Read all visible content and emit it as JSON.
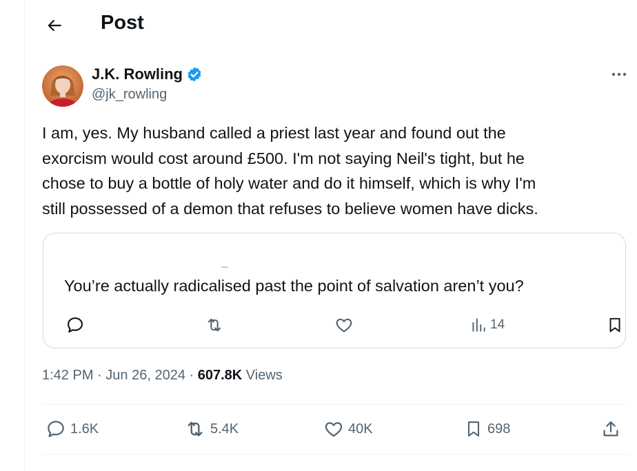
{
  "header": {
    "title": "Post",
    "back_icon": "arrow-left-icon"
  },
  "author": {
    "name": "J.K. Rowling",
    "handle": "@jk_rowling",
    "verified": true,
    "verified_color": "#1d9bf0"
  },
  "tweet": {
    "lines": [
      "I am, yes. My husband called a priest last year and found out the",
      "exorcism would cost around £500. I'm not saying Neil's tight, but he",
      "chose to buy a bottle of holy water and do it himself, which is why I'm",
      "still possessed of a demon that refuses to believe women have dicks."
    ]
  },
  "quote": {
    "text": "You’re actually radicalised past the point of salvation aren’t you?",
    "views": "14"
  },
  "meta": {
    "time": "1:42 PM",
    "date": "Jun 26, 2024",
    "views_count": "607.8K",
    "views_label": "Views"
  },
  "actions": {
    "replies": "1.6K",
    "reposts": "5.4K",
    "likes": "40K",
    "bookmarks": "698"
  },
  "colors": {
    "text": "#0f1419",
    "secondary": "#536471",
    "border": "#cfd9de",
    "accent": "#1d9bf0"
  }
}
